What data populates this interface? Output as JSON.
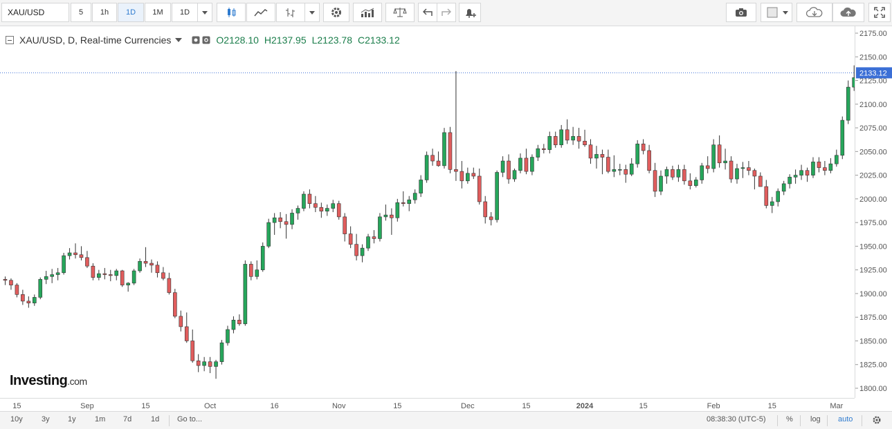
{
  "toolbar": {
    "symbol": "XAU/USD",
    "intervals": [
      "5",
      "1h",
      "1D",
      "1M",
      "1D"
    ],
    "active_interval_index": 2
  },
  "legend": {
    "title": "XAU/USD, D, Real-time Currencies",
    "open": "O2128.10",
    "high": "H2137.95",
    "low": "L2123.78",
    "close": "C2133.12"
  },
  "last_price_label": "2133.12",
  "watermark": {
    "brand": "Investing",
    "suffix": ".com"
  },
  "bottom_bar": {
    "ranges": [
      "10y",
      "3y",
      "1y",
      "1m",
      "7d",
      "1d"
    ],
    "goto": "Go to...",
    "clock": "08:38:30 (UTC-5)",
    "percent": "%",
    "log": "log",
    "auto": "auto"
  },
  "colors": {
    "up": "#26a65b",
    "down": "#e05d5d",
    "last_price": "#3b6fd6",
    "accent": "#2e7bcf"
  },
  "chart_data": {
    "type": "candlestick",
    "title": "XAU/USD, D, Real-time Currencies",
    "ylim": [
      1790,
      2180
    ],
    "y_ticks": [
      1800,
      1825,
      1850,
      1875,
      1900,
      1925,
      1950,
      1975,
      2000,
      2025,
      2050,
      2075,
      2100,
      2125,
      2150,
      2175
    ],
    "y_tick_labels": [
      "1800.00",
      "1825.00",
      "1850.00",
      "1875.00",
      "1900.00",
      "1925.00",
      "1950.00",
      "1975.00",
      "2000.00",
      "2025.00",
      "2050.00",
      "2075.00",
      "2100.00",
      "2125.00",
      "2150.00",
      "2175.00"
    ],
    "x_labels": [
      {
        "label": "15",
        "index": 2
      },
      {
        "label": "Sep",
        "index": 14
      },
      {
        "label": "15",
        "index": 24
      },
      {
        "label": "Oct",
        "index": 35
      },
      {
        "label": "16",
        "index": 46
      },
      {
        "label": "Nov",
        "index": 57
      },
      {
        "label": "15",
        "index": 67
      },
      {
        "label": "Dec",
        "index": 79
      },
      {
        "label": "15",
        "index": 89
      },
      {
        "label": "2024",
        "index": 99
      },
      {
        "label": "15",
        "index": 109
      },
      {
        "label": "Feb",
        "index": 121
      },
      {
        "label": "15",
        "index": 131
      },
      {
        "label": "Mar",
        "index": 142
      }
    ],
    "last_price": 2133.12,
    "candles": [
      [
        1915,
        1918,
        1909,
        1914
      ],
      [
        1914,
        1916,
        1904,
        1909
      ],
      [
        1909,
        1911,
        1896,
        1899
      ],
      [
        1899,
        1904,
        1888,
        1892
      ],
      [
        1892,
        1897,
        1885,
        1890
      ],
      [
        1890,
        1899,
        1887,
        1896
      ],
      [
        1896,
        1917,
        1894,
        1915
      ],
      [
        1915,
        1924,
        1910,
        1918
      ],
      [
        1918,
        1926,
        1911,
        1920
      ],
      [
        1920,
        1927,
        1914,
        1922
      ],
      [
        1922,
        1943,
        1920,
        1940
      ],
      [
        1940,
        1948,
        1936,
        1943
      ],
      [
        1943,
        1953,
        1937,
        1941
      ],
      [
        1941,
        1950,
        1935,
        1938
      ],
      [
        1938,
        1945,
        1927,
        1929
      ],
      [
        1929,
        1932,
        1914,
        1917
      ],
      [
        1917,
        1925,
        1914,
        1921
      ],
      [
        1921,
        1927,
        1915,
        1920
      ],
      [
        1920,
        1925,
        1913,
        1919
      ],
      [
        1919,
        1926,
        1914,
        1924
      ],
      [
        1924,
        1925,
        1907,
        1909
      ],
      [
        1909,
        1912,
        1902,
        1911
      ],
      [
        1911,
        1926,
        1909,
        1924
      ],
      [
        1924,
        1937,
        1922,
        1934
      ],
      [
        1934,
        1949,
        1928,
        1932
      ],
      [
        1932,
        1936,
        1922,
        1930
      ],
      [
        1930,
        1934,
        1917,
        1922
      ],
      [
        1922,
        1928,
        1914,
        1916
      ],
      [
        1916,
        1922,
        1899,
        1901
      ],
      [
        1901,
        1905,
        1874,
        1876
      ],
      [
        1876,
        1882,
        1860,
        1865
      ],
      [
        1865,
        1880,
        1848,
        1850
      ],
      [
        1850,
        1862,
        1827,
        1829
      ],
      [
        1829,
        1836,
        1817,
        1824
      ],
      [
        1824,
        1833,
        1818,
        1828
      ],
      [
        1828,
        1833,
        1816,
        1823
      ],
      [
        1823,
        1830,
        1810,
        1828
      ],
      [
        1828,
        1851,
        1825,
        1848
      ],
      [
        1848,
        1866,
        1845,
        1862
      ],
      [
        1862,
        1876,
        1858,
        1872
      ],
      [
        1872,
        1878,
        1866,
        1868
      ],
      [
        1868,
        1935,
        1866,
        1931
      ],
      [
        1931,
        1934,
        1914,
        1918
      ],
      [
        1918,
        1935,
        1915,
        1925
      ],
      [
        1925,
        1954,
        1923,
        1950
      ],
      [
        1950,
        1979,
        1948,
        1975
      ],
      [
        1975,
        1985,
        1962,
        1980
      ],
      [
        1980,
        1986,
        1969,
        1976
      ],
      [
        1976,
        1984,
        1958,
        1973
      ],
      [
        1973,
        1989,
        1968,
        1985
      ],
      [
        1985,
        1993,
        1978,
        1990
      ],
      [
        1990,
        2008,
        1987,
        2005
      ],
      [
        2005,
        2010,
        1990,
        1995
      ],
      [
        1995,
        2003,
        1986,
        1991
      ],
      [
        1991,
        1996,
        1980,
        1987
      ],
      [
        1987,
        1994,
        1982,
        1990
      ],
      [
        1990,
        1999,
        1986,
        1995
      ],
      [
        1995,
        1998,
        1978,
        1981
      ],
      [
        1981,
        1985,
        1955,
        1963
      ],
      [
        1963,
        1971,
        1948,
        1952
      ],
      [
        1952,
        1963,
        1935,
        1940
      ],
      [
        1940,
        1952,
        1933,
        1948
      ],
      [
        1948,
        1963,
        1945,
        1960
      ],
      [
        1960,
        1967,
        1953,
        1958
      ],
      [
        1958,
        1985,
        1955,
        1981
      ],
      [
        1981,
        1994,
        1977,
        1983
      ],
      [
        1983,
        1990,
        1962,
        1980
      ],
      [
        1980,
        2000,
        1976,
        1996
      ],
      [
        1996,
        2008,
        1992,
        1995
      ],
      [
        1995,
        2003,
        1987,
        1999
      ],
      [
        1999,
        2010,
        1995,
        2006
      ],
      [
        2006,
        2025,
        2002,
        2020
      ],
      [
        2020,
        2050,
        2017,
        2046
      ],
      [
        2046,
        2053,
        2035,
        2040
      ],
      [
        2040,
        2050,
        2034,
        2035
      ],
      [
        2035,
        2075,
        2032,
        2070
      ],
      [
        2070,
        2076,
        2027,
        2031
      ],
      [
        2031,
        2135,
        2019,
        2029
      ],
      [
        2029,
        2040,
        2011,
        2019
      ],
      [
        2019,
        2033,
        2016,
        2027
      ],
      [
        2027,
        2033,
        2021,
        2024
      ],
      [
        2024,
        2032,
        1994,
        1997
      ],
      [
        1997,
        2003,
        1974,
        1981
      ],
      [
        1981,
        1986,
        1972,
        1978
      ],
      [
        1978,
        2030,
        1975,
        2028
      ],
      [
        2028,
        2045,
        2023,
        2040
      ],
      [
        2040,
        2047,
        2016,
        2021
      ],
      [
        2021,
        2032,
        2018,
        2030
      ],
      [
        2030,
        2048,
        2027,
        2043
      ],
      [
        2043,
        2053,
        2026,
        2029
      ],
      [
        2029,
        2047,
        2025,
        2044
      ],
      [
        2044,
        2057,
        2040,
        2053
      ],
      [
        2053,
        2058,
        2048,
        2052
      ],
      [
        2052,
        2071,
        2048,
        2066
      ],
      [
        2066,
        2071,
        2054,
        2057
      ],
      [
        2057,
        2078,
        2054,
        2073
      ],
      [
        2073,
        2084,
        2058,
        2062
      ],
      [
        2062,
        2076,
        2057,
        2066
      ],
      [
        2066,
        2075,
        2053,
        2061
      ],
      [
        2061,
        2073,
        2055,
        2057
      ],
      [
        2057,
        2063,
        2037,
        2043
      ],
      [
        2043,
        2056,
        2032,
        2047
      ],
      [
        2047,
        2052,
        2026,
        2044
      ],
      [
        2044,
        2052,
        2027,
        2029
      ],
      [
        2029,
        2046,
        2023,
        2031
      ],
      [
        2031,
        2037,
        2025,
        2031
      ],
      [
        2031,
        2036,
        2017,
        2026
      ],
      [
        2026,
        2043,
        2024,
        2037
      ],
      [
        2037,
        2062,
        2033,
        2058
      ],
      [
        2058,
        2063,
        2047,
        2051
      ],
      [
        2051,
        2057,
        2027,
        2030
      ],
      [
        2030,
        2038,
        2002,
        2008
      ],
      [
        2008,
        2030,
        2004,
        2024
      ],
      [
        2024,
        2034,
        2016,
        2031
      ],
      [
        2031,
        2035,
        2020,
        2023
      ],
      [
        2023,
        2036,
        2018,
        2031
      ],
      [
        2031,
        2036,
        2015,
        2019
      ],
      [
        2019,
        2027,
        2010,
        2014
      ],
      [
        2014,
        2023,
        2012,
        2020
      ],
      [
        2020,
        2038,
        2016,
        2035
      ],
      [
        2035,
        2045,
        2027,
        2032
      ],
      [
        2032,
        2063,
        2028,
        2057
      ],
      [
        2057,
        2067,
        2033,
        2038
      ],
      [
        2038,
        2053,
        2031,
        2040
      ],
      [
        2040,
        2045,
        2017,
        2021
      ],
      [
        2021,
        2037,
        2016,
        2032
      ],
      [
        2032,
        2039,
        2022,
        2033
      ],
      [
        2033,
        2040,
        2025,
        2030
      ],
      [
        2030,
        2032,
        2010,
        2024
      ],
      [
        2024,
        2028,
        2013,
        2013
      ],
      [
        2013,
        2020,
        1990,
        1993
      ],
      [
        1993,
        2002,
        1985,
        1997
      ],
      [
        1997,
        2011,
        1992,
        2008
      ],
      [
        2008,
        2019,
        2004,
        2016
      ],
      [
        2016,
        2026,
        2011,
        2023
      ],
      [
        2023,
        2031,
        2016,
        2025
      ],
      [
        2025,
        2036,
        2020,
        2030
      ],
      [
        2030,
        2033,
        2018,
        2025
      ],
      [
        2025,
        2044,
        2022,
        2039
      ],
      [
        2039,
        2044,
        2028,
        2033
      ],
      [
        2033,
        2040,
        2025,
        2030
      ],
      [
        2030,
        2043,
        2027,
        2037
      ],
      [
        2037,
        2052,
        2034,
        2046
      ],
      [
        2046,
        2087,
        2042,
        2083
      ],
      [
        2083,
        2125,
        2079,
        2118
      ],
      [
        2118,
        2141,
        2114,
        2128
      ],
      [
        2128,
        2138,
        2124,
        2133
      ]
    ]
  }
}
